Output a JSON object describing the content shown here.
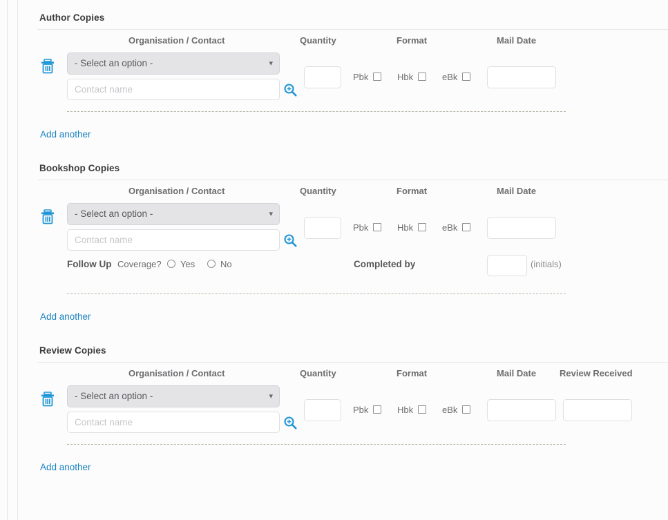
{
  "theme": {
    "accent_link": "#1781c2",
    "icon_blue": "#2196d6",
    "text_gray": "#6d6d70",
    "select_bg": "#e4e4e7",
    "dash_color": "#b9b5a6",
    "page_bg": "#fcfcfc"
  },
  "common": {
    "select_placeholder": "- Select an option -",
    "contact_placeholder": "Contact name",
    "add_another": "Add another",
    "trash_icon": "trash-icon",
    "magnifier_icon": "magnifier-zoom-in-icon",
    "caret_icon": "chevron-down-icon"
  },
  "columns": {
    "organisation": "Organisation / Contact",
    "quantity": "Quantity",
    "format": "Format",
    "mail_date": "Mail Date",
    "review_received": "Review Received"
  },
  "formats": [
    {
      "label": "Pbk",
      "checked": false
    },
    {
      "label": "Hbk",
      "checked": false
    },
    {
      "label": "eBk",
      "checked": false
    }
  ],
  "sections": [
    {
      "id": "author-copies",
      "title": "Author Copies",
      "has_review_column": false,
      "has_followup": false,
      "row": {
        "organisation_value": "",
        "contact_value": "",
        "quantity_value": "",
        "mail_date_value": ""
      }
    },
    {
      "id": "bookshop-copies",
      "title": "Bookshop Copies",
      "has_review_column": false,
      "has_followup": true,
      "row": {
        "organisation_value": "",
        "contact_value": "",
        "quantity_value": "",
        "mail_date_value": ""
      },
      "followup": {
        "label": "Follow Up",
        "question": "Coverage?",
        "options": [
          {
            "label": "Yes",
            "selected": false
          },
          {
            "label": "No",
            "selected": false
          }
        ],
        "completed_by_label": "Completed by",
        "completed_by_value": "",
        "initials_note": "(initials)"
      }
    },
    {
      "id": "review-copies",
      "title": "Review Copies",
      "has_review_column": true,
      "has_followup": false,
      "row": {
        "organisation_value": "",
        "contact_value": "",
        "quantity_value": "",
        "mail_date_value": "",
        "review_received_value": ""
      }
    }
  ]
}
